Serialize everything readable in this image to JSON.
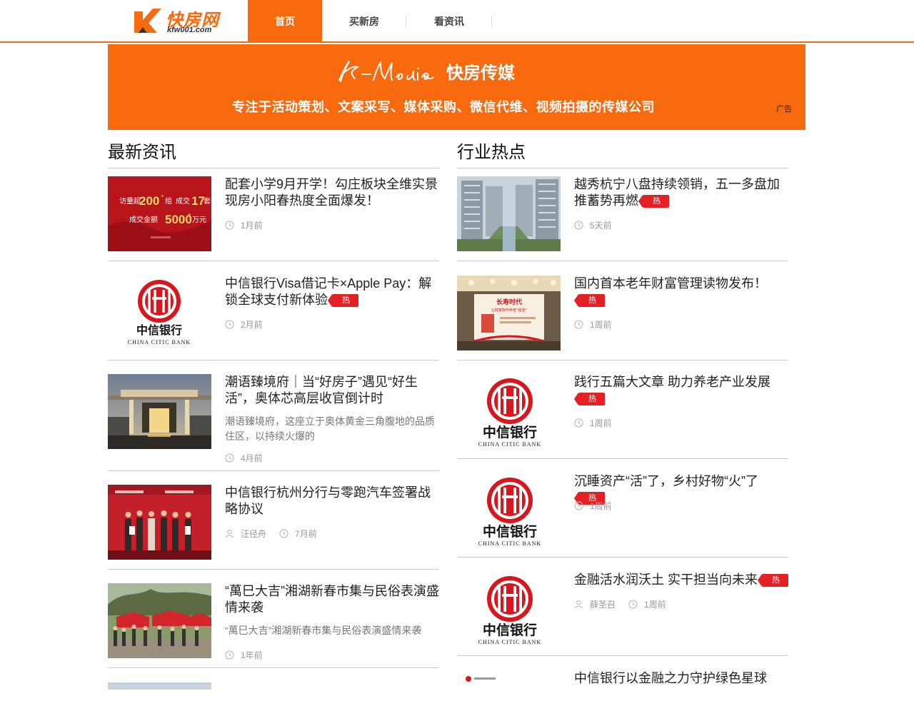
{
  "header": {
    "brand": "快房网",
    "domain": "kfw001.com",
    "nav": [
      "首页",
      "买新房",
      "看资讯"
    ]
  },
  "banner": {
    "script": "K-Media",
    "name": "快房传媒",
    "slogan": "专注于活动策划、文案采写、媒体采购、微信代维、视频拍摄的传媒公司",
    "ad_label": "广告"
  },
  "left": {
    "title": "最新资讯",
    "items": [
      {
        "title": "配套小学9月开学！勾庄板块全维实景现房小阳春热度全面爆发！",
        "time": "1月前",
        "thumb": {
          "l1": "访量超",
          "n1": "200",
          "s1": "+",
          "l2": "组",
          "l3": "成交",
          "n2": "17",
          "l4": "套",
          "l5": "成交金额",
          "n3": "5000",
          "s3": "+",
          "l6": "万元"
        }
      },
      {
        "title": "中信银行Visa借记卡×Apple Pay：解锁全球支付新体验",
        "hot": "热",
        "time": "2月前",
        "thumb": {
          "cn": "中信银行",
          "en": "CHINA CITIC BANK"
        }
      },
      {
        "title": "潮语臻境府｜当“好房子”遇见“好生活”，奥体芯高层收官倒计时",
        "desc": "潮语臻境府，这座立于奥体黄金三角腹地的品质住区，以持续火爆的",
        "time": "4月前"
      },
      {
        "title": "中信银行杭州分行与零跑汽车签署战略协议",
        "author": "汪径舟",
        "time": "7月前"
      },
      {
        "title": "“萬巳大吉”湘湖新春市集与民俗表演盛情来袭",
        "desc": "“萬巳大吉”湘湖新春市集与民俗表演盛情来袭",
        "time": "1年前"
      }
    ]
  },
  "right": {
    "title": "行业热点",
    "items": [
      {
        "title": "越秀杭宁八盘持续领销，五一多盘加推蓄势再燃",
        "hot": "热",
        "time": "5天前"
      },
      {
        "title": "国内首本老年财富管理读物发布！",
        "hot": "热",
        "time": "1周前",
        "thumb": {
          "t1": "长寿时代",
          "t2": "让财富陪伴养老“钱途”"
        }
      },
      {
        "title": "践行五篇大文章 助力养老产业发展",
        "hot": "热",
        "time": "1周前",
        "thumb": {
          "cn": "中信银行",
          "en": "CHINA CITIC BANK"
        }
      },
      {
        "title": "沉睡资产“活”了，乡村好物“火”了",
        "hot": "热",
        "time": "1周前",
        "thumb": {
          "cn": "中信银行",
          "en": "CHINA CITIC BANK"
        }
      },
      {
        "title": "金融活水润沃土 实干担当向未来",
        "hot": "热",
        "author": "薛圣召",
        "time": "1周前",
        "thumb": {
          "cn": "中信银行",
          "en": "CHINA CITIC BANK"
        }
      },
      {
        "title": "中信银行以金融之力守护绿色星球"
      }
    ]
  },
  "colors": {
    "accent": "#f96a0e",
    "hot": "#e32024",
    "citic_red": "#d7161d"
  }
}
